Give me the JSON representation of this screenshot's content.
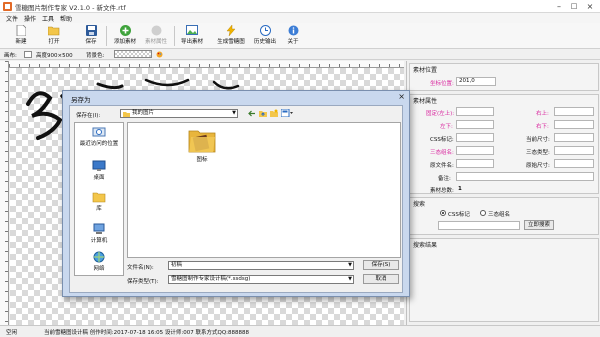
{
  "window": {
    "title": "雪糖图片制作专家 V2.1.0 - 新文件.rtf",
    "min": "–",
    "max": "□",
    "close": "×"
  },
  "menu": [
    "文件",
    "操作",
    "工具",
    "帮助"
  ],
  "toolbar": {
    "new": "新建",
    "open": "打开",
    "save": "保存",
    "add_material": "添加素材",
    "material_attr": "素材属性",
    "export_material": "导出素材",
    "generate_gif": "生成雪糖图",
    "history_export": "历史输出",
    "about": "关于"
  },
  "propbar": {
    "canvas_label": "画布:",
    "canvas_size": "高度900×500",
    "bg_label": "背景色:"
  },
  "panel": {
    "material_position_header": "素材位置",
    "position_label": "坐标位置:",
    "position_value": "201,0",
    "material_props_header": "素材属性",
    "fields": {
      "fixed_left": "固定(左上):",
      "right_top": "右上:",
      "left_bottom": "左下:",
      "right_bottom": "右下:",
      "css_tag": "CSS标记:",
      "current_size": "当前尺寸:",
      "three_state_name": "三态组名:",
      "three_state_type": "三态类型:",
      "original_file": "原文件名:",
      "original_size": "原始尺寸:",
      "note": "备注:"
    },
    "total_label": "素材总数:",
    "total_value": "1",
    "search_header": "搜索",
    "radio_css": "CSS标记",
    "radio_group": "三态组名",
    "search_button": "立即搜索",
    "results_header": "搜索结果"
  },
  "dialog": {
    "title": "另存为",
    "save_in_label": "保存在(I):",
    "save_in_value": "我的图片",
    "places": [
      "最近访问的位置",
      "桌面",
      "库",
      "计算机",
      "网络"
    ],
    "file_item": "图标",
    "filename_label": "文件名(N):",
    "filename_value": "初稿",
    "filetype_label": "保存类型(T):",
    "filetype_value": "雪糖图制作专家设计稿(*.ssdsg)",
    "save_button": "保存(S)",
    "cancel_button": "取消"
  },
  "status": {
    "mode": "空闲",
    "info": "当前雪糖图设计稿 创作时间:2017-07-18 16:05 设计师:007 联系方式QQ:888888"
  },
  "colors": {
    "accent_pink": "#d9269e",
    "dialog_frame": "#c9d8ee"
  }
}
